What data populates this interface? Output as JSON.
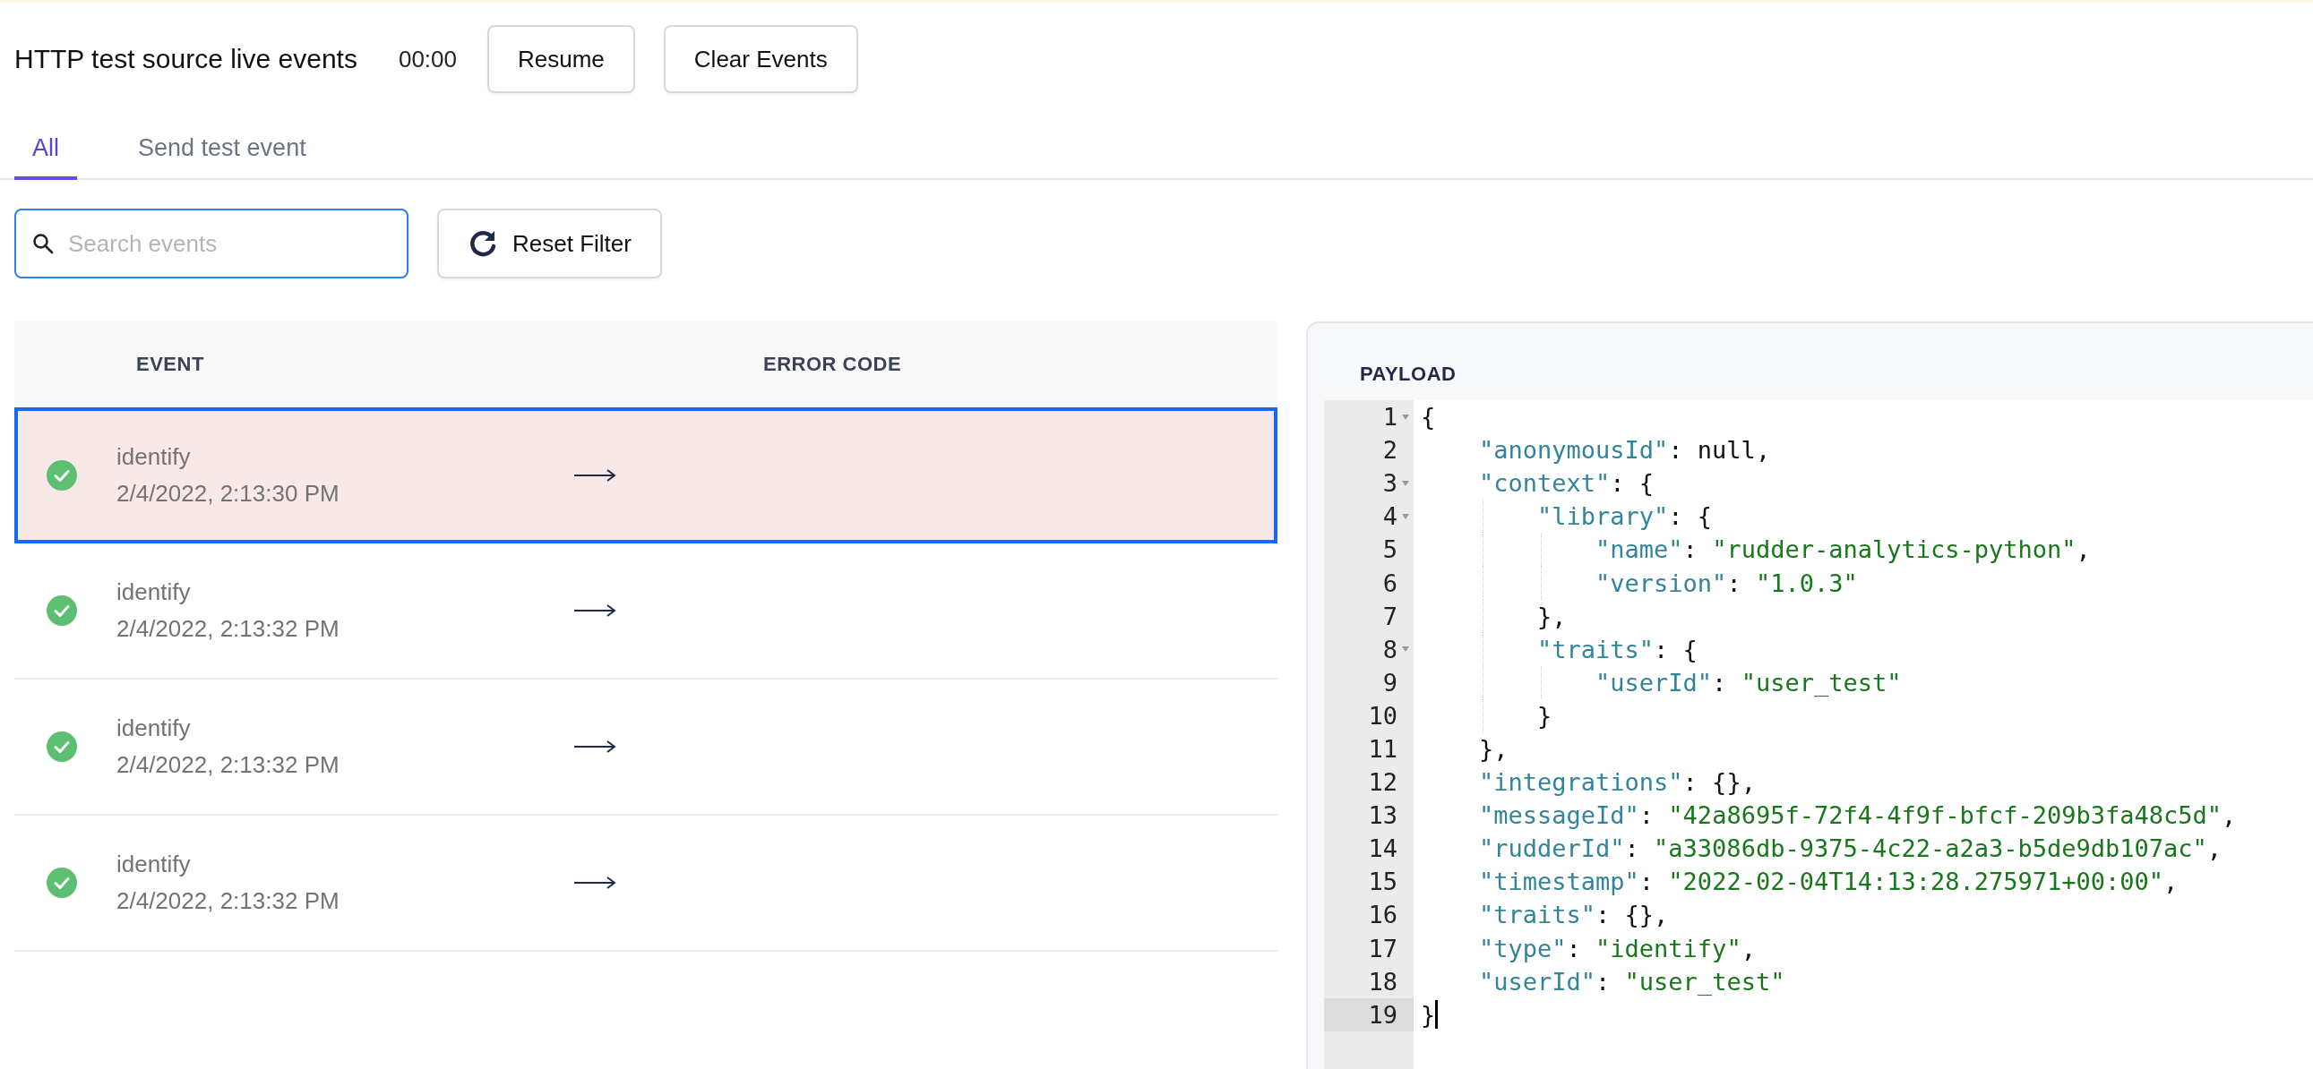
{
  "header": {
    "title": "HTTP test source live events",
    "timer": "00:00",
    "buttons": [
      "Resume",
      "Clear Events"
    ]
  },
  "tabs": [
    {
      "label": "All",
      "selected": true
    },
    {
      "label": "Send test event",
      "selected": false
    }
  ],
  "search": {
    "placeholder": "Search events"
  },
  "reset_button": "Reset Filter",
  "table": {
    "columns": [
      "EVENT",
      "ERROR CODE"
    ],
    "rows": [
      {
        "event": "identify",
        "time": "2/4/2022, 2:13:30 PM",
        "selected": true
      },
      {
        "event": "identify",
        "time": "2/4/2022, 2:13:32 PM",
        "selected": false
      },
      {
        "event": "identify",
        "time": "2/4/2022, 2:13:32 PM",
        "selected": false
      },
      {
        "event": "identify",
        "time": "2/4/2022, 2:13:32 PM",
        "selected": false
      }
    ]
  },
  "payload": {
    "title": "PAYLOAD",
    "lines": [
      {
        "number": "1",
        "fold": true,
        "active": false,
        "tokens": [
          {
            "kind": "plain",
            "text": "{"
          }
        ]
      },
      {
        "number": "2",
        "fold": false,
        "active": false,
        "tokens": [
          {
            "kind": "key",
            "text": "    \"anonymousId\""
          },
          {
            "kind": "plain",
            "text": ": null,"
          }
        ]
      },
      {
        "number": "3",
        "fold": true,
        "active": false,
        "tokens": [
          {
            "kind": "key",
            "text": "    \"context\""
          },
          {
            "kind": "plain",
            "text": ": {"
          }
        ]
      },
      {
        "number": "4",
        "fold": true,
        "active": false,
        "tokens": [
          {
            "kind": "key",
            "text": "        \"library\""
          },
          {
            "kind": "plain",
            "text": ": {"
          }
        ]
      },
      {
        "number": "5",
        "fold": false,
        "active": false,
        "tokens": [
          {
            "kind": "key",
            "text": "            \"name\""
          },
          {
            "kind": "plain",
            "text": ": "
          },
          {
            "kind": "string",
            "text": "\"rudder-analytics-python\""
          },
          {
            "kind": "plain",
            "text": ","
          }
        ]
      },
      {
        "number": "6",
        "fold": false,
        "active": false,
        "tokens": [
          {
            "kind": "key",
            "text": "            \"version\""
          },
          {
            "kind": "plain",
            "text": ": "
          },
          {
            "kind": "string",
            "text": "\"1.0.3\""
          }
        ]
      },
      {
        "number": "7",
        "fold": false,
        "active": false,
        "tokens": [
          {
            "kind": "plain",
            "text": "        },"
          }
        ]
      },
      {
        "number": "8",
        "fold": true,
        "active": false,
        "tokens": [
          {
            "kind": "key",
            "text": "        \"traits\""
          },
          {
            "kind": "plain",
            "text": ": {"
          }
        ]
      },
      {
        "number": "9",
        "fold": false,
        "active": false,
        "tokens": [
          {
            "kind": "key",
            "text": "            \"userId\""
          },
          {
            "kind": "plain",
            "text": ": "
          },
          {
            "kind": "string",
            "text": "\"user_test\""
          }
        ]
      },
      {
        "number": "10",
        "fold": false,
        "active": false,
        "tokens": [
          {
            "kind": "plain",
            "text": "        }"
          }
        ]
      },
      {
        "number": "11",
        "fold": false,
        "active": false,
        "tokens": [
          {
            "kind": "plain",
            "text": "    },"
          }
        ]
      },
      {
        "number": "12",
        "fold": false,
        "active": false,
        "tokens": [
          {
            "kind": "key",
            "text": "    \"integrations\""
          },
          {
            "kind": "plain",
            "text": ": {},"
          }
        ]
      },
      {
        "number": "13",
        "fold": false,
        "active": false,
        "tokens": [
          {
            "kind": "key",
            "text": "    \"messageId\""
          },
          {
            "kind": "plain",
            "text": ": "
          },
          {
            "kind": "string",
            "text": "\"42a8695f-72f4-4f9f-bfcf-209b3fa48c5d\""
          },
          {
            "kind": "plain",
            "text": ","
          }
        ]
      },
      {
        "number": "14",
        "fold": false,
        "active": false,
        "tokens": [
          {
            "kind": "key",
            "text": "    \"rudderId\""
          },
          {
            "kind": "plain",
            "text": ": "
          },
          {
            "kind": "string",
            "text": "\"a33086db-9375-4c22-a2a3-b5de9db107ac\""
          },
          {
            "kind": "plain",
            "text": ","
          }
        ]
      },
      {
        "number": "15",
        "fold": false,
        "active": false,
        "tokens": [
          {
            "kind": "key",
            "text": "    \"timestamp\""
          },
          {
            "kind": "plain",
            "text": ": "
          },
          {
            "kind": "string",
            "text": "\"2022-02-04T14:13:28.275971+00:00\""
          },
          {
            "kind": "plain",
            "text": ","
          }
        ]
      },
      {
        "number": "16",
        "fold": false,
        "active": false,
        "tokens": [
          {
            "kind": "key",
            "text": "    \"traits\""
          },
          {
            "kind": "plain",
            "text": ": {},"
          }
        ]
      },
      {
        "number": "17",
        "fold": false,
        "active": false,
        "tokens": [
          {
            "kind": "key",
            "text": "    \"type\""
          },
          {
            "kind": "plain",
            "text": ": "
          },
          {
            "kind": "string",
            "text": "\"identify\""
          },
          {
            "kind": "plain",
            "text": ","
          }
        ]
      },
      {
        "number": "18",
        "fold": false,
        "active": false,
        "tokens": [
          {
            "kind": "key",
            "text": "    \"userId\""
          },
          {
            "kind": "plain",
            "text": ": "
          },
          {
            "kind": "string",
            "text": "\"user_test\""
          }
        ]
      },
      {
        "number": "19",
        "fold": false,
        "active": true,
        "tokens": [
          {
            "kind": "plain",
            "text": "}"
          }
        ]
      }
    ]
  }
}
